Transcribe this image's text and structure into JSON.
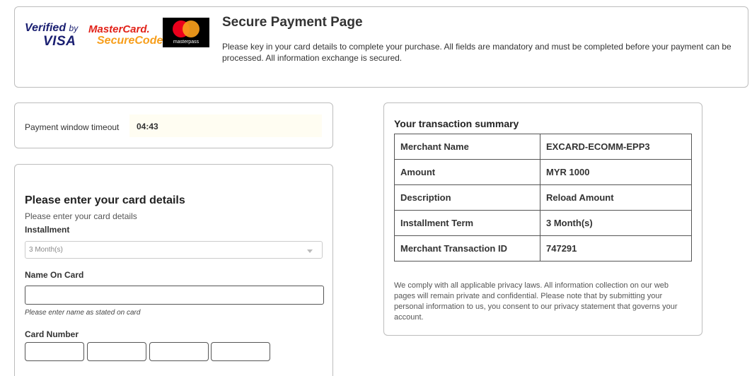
{
  "header": {
    "logos": {
      "verified_by": "Verified",
      "by": "by",
      "visa": "VISA",
      "mastercard": "MasterCard.",
      "securecode": "SecureCode.",
      "masterpass": "masterpass"
    },
    "title": "Secure Payment Page",
    "description": "Please key in your card details to complete your purchase. All fields are mandatory and must be completed before your payment can be processed. All information exchange is secured."
  },
  "timeout": {
    "label": "Payment window timeout",
    "value": "04:43"
  },
  "card_form": {
    "title": "Please enter your card details",
    "subtitle": "Please enter your card details",
    "installment_label": "Installment",
    "installment_value": "3 Month(s)",
    "name_label": "Name On Card",
    "name_value": "",
    "name_hint": "Please enter name as stated on card",
    "card_number_label": "Card Number"
  },
  "summary": {
    "title": "Your transaction summary",
    "rows": [
      {
        "label": "Merchant Name",
        "value": "EXCARD-ECOMM-EPP3"
      },
      {
        "label": "Amount",
        "value": "MYR 1000"
      },
      {
        "label": "Description",
        "value": "Reload Amount"
      },
      {
        "label": "Installment Term",
        "value": "3 Month(s)"
      },
      {
        "label": "Merchant Transaction ID",
        "value": "747291"
      }
    ],
    "privacy": "We comply with all applicable privacy laws. All information collection on our web pages will remain private and confidential. Please note that by submitting your personal information to us, you consent to our privacy statement that governs your account."
  },
  "colors": {
    "visa_blue": "#1a1f71",
    "mastercard_red": "#eb001b",
    "mastercard_yellow": "#f79e1b",
    "timeout_bg": "#fffdf2",
    "border": "#bdbdbd"
  }
}
